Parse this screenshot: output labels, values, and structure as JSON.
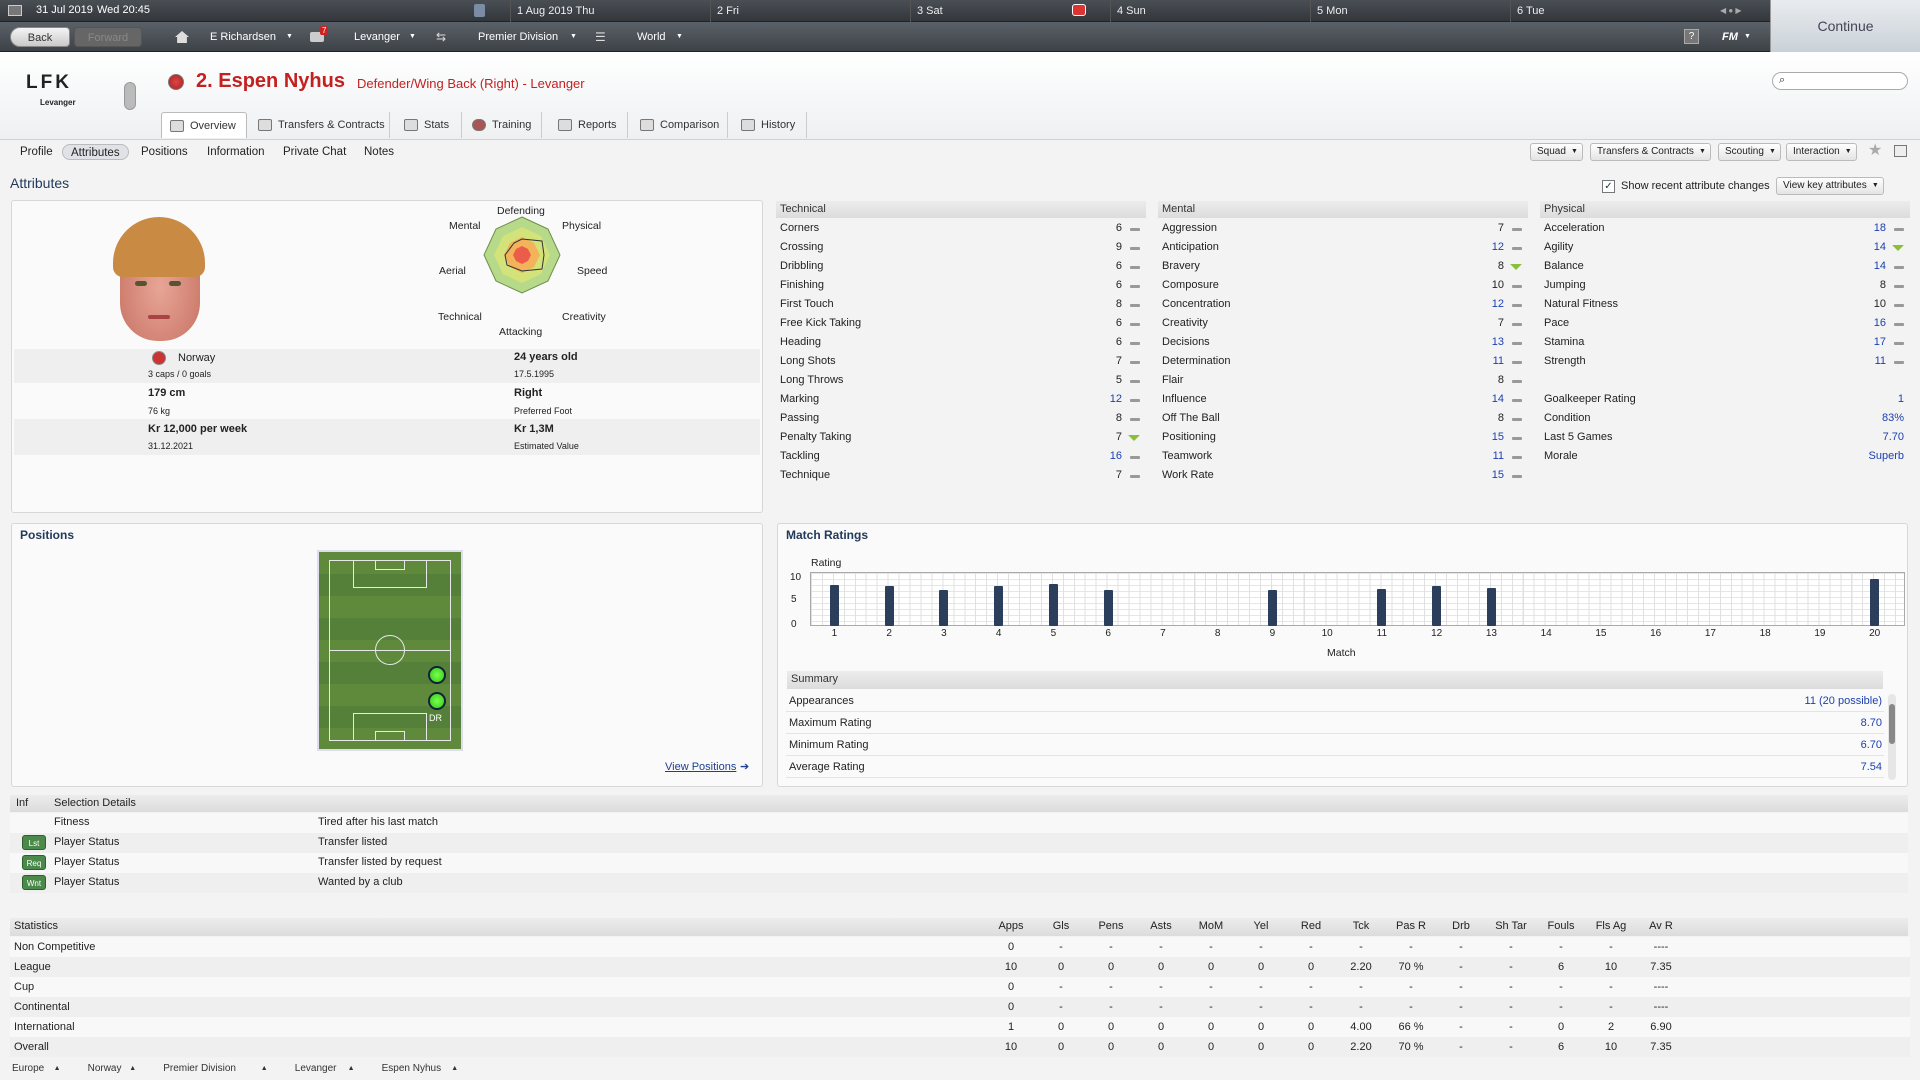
{
  "topbar": {
    "date": "31 Jul 2019",
    "day": "Wed 20:45",
    "cal": [
      "1 Aug 2019  Thu",
      "2  Fri",
      "3  Sat",
      "4  Sun",
      "5  Mon",
      "6  Tue"
    ]
  },
  "nav": {
    "back": "Back",
    "forward": "Forward",
    "manager": "E Richardsen",
    "club": "Levanger",
    "division": "Premier Division",
    "world": "World",
    "fm": "FM",
    "mail_count": "7",
    "continue": "Continue"
  },
  "player": {
    "title": "2. Espen Nyhus",
    "role": "Defender/Wing Back (Right) - Levanger",
    "club_logo": "LFK",
    "club_caption": "Levanger"
  },
  "tabs": [
    "Overview",
    "Transfers & Contracts",
    "Stats",
    "Training",
    "Reports",
    "Comparison",
    "History"
  ],
  "subnav": [
    "Profile",
    "Attributes",
    "Positions",
    "Information",
    "Private Chat",
    "Notes"
  ],
  "dropdowns": [
    "Squad",
    "Transfers & Contracts",
    "Scouting",
    "Interaction"
  ],
  "section_title": "Attributes",
  "show_recent": "Show recent attribute changes",
  "view_key": "View key attributes",
  "radar_labels": {
    "defending": "Defending",
    "physical": "Physical",
    "speed": "Speed",
    "creativity": "Creativity",
    "attacking": "Attacking",
    "technical": "Technical",
    "aerial": "Aerial",
    "mental": "Mental"
  },
  "bio": {
    "nation": "Norway",
    "caps": "3 caps / 0 goals",
    "age": "24 years old",
    "dob": "17.5.1995",
    "height": "179 cm",
    "foot": "Right",
    "weight": "76 kg",
    "foot_label": "Preferred Foot",
    "wage": "Kr 12,000 per week",
    "value": "Kr 1,3M",
    "contract": "31.12.2021",
    "value_label": "Estimated Value"
  },
  "technical": {
    "title": "Technical",
    "items": [
      [
        "Corners",
        "6",
        "n"
      ],
      [
        "Crossing",
        "9",
        "n"
      ],
      [
        "Dribbling",
        "6",
        "n"
      ],
      [
        "Finishing",
        "6",
        "n"
      ],
      [
        "First Touch",
        "8",
        "n"
      ],
      [
        "Free Kick Taking",
        "6",
        "n"
      ],
      [
        "Heading",
        "6",
        "n"
      ],
      [
        "Long Shots",
        "7",
        "n"
      ],
      [
        "Long Throws",
        "5",
        "n"
      ],
      [
        "Marking",
        "12",
        "n"
      ],
      [
        "Passing",
        "8",
        "n"
      ],
      [
        "Penalty Taking",
        "7",
        "u"
      ],
      [
        "Tackling",
        "16",
        "n"
      ],
      [
        "Technique",
        "7",
        "n"
      ]
    ]
  },
  "mental": {
    "title": "Mental",
    "items": [
      [
        "Aggression",
        "7",
        "n"
      ],
      [
        "Anticipation",
        "12",
        "n"
      ],
      [
        "Bravery",
        "8",
        "u"
      ],
      [
        "Composure",
        "10",
        "n"
      ],
      [
        "Concentration",
        "12",
        "n"
      ],
      [
        "Creativity",
        "7",
        "n"
      ],
      [
        "Decisions",
        "13",
        "n"
      ],
      [
        "Determination",
        "11",
        "n"
      ],
      [
        "Flair",
        "8",
        "n"
      ],
      [
        "Influence",
        "14",
        "n"
      ],
      [
        "Off The Ball",
        "8",
        "n"
      ],
      [
        "Positioning",
        "15",
        "n"
      ],
      [
        "Teamwork",
        "11",
        "n"
      ],
      [
        "Work Rate",
        "15",
        "n"
      ]
    ]
  },
  "physical": {
    "title": "Physical",
    "items": [
      [
        "Acceleration",
        "18",
        "n"
      ],
      [
        "Agility",
        "14",
        "u"
      ],
      [
        "Balance",
        "14",
        "n"
      ],
      [
        "Jumping",
        "8",
        "n"
      ],
      [
        "Natural Fitness",
        "10",
        "n"
      ],
      [
        "Pace",
        "16",
        "n"
      ],
      [
        "Stamina",
        "17",
        "n"
      ],
      [
        "Strength",
        "11",
        "n"
      ]
    ],
    "extra": [
      [
        "Goalkeeper Rating",
        "1"
      ],
      [
        "Condition",
        "83%"
      ],
      [
        "Last 5 Games",
        "7.70"
      ],
      [
        "Morale",
        "Superb"
      ]
    ]
  },
  "positions": {
    "title": "Positions",
    "view_link": "View Positions",
    "label": "DR"
  },
  "match_ratings": {
    "title": "Match Ratings",
    "ylabel": "Rating",
    "xlabel": "Match",
    "yticks": [
      "10",
      "5",
      "0"
    ]
  },
  "chart_data": {
    "type": "bar",
    "title": "Match Ratings",
    "xlabel": "Match",
    "ylabel": "Rating",
    "ylim": [
      0,
      10
    ],
    "categories": [
      "1",
      "2",
      "3",
      "4",
      "5",
      "6",
      "7",
      "8",
      "9",
      "10",
      "11",
      "12",
      "13",
      "14",
      "15",
      "16",
      "17",
      "18",
      "19",
      "20"
    ],
    "values": [
      7.6,
      7.5,
      6.7,
      7.5,
      7.7,
      6.6,
      null,
      null,
      6.6,
      null,
      6.8,
      7.5,
      7.0,
      null,
      null,
      null,
      null,
      null,
      null,
      8.7
    ]
  },
  "summary": {
    "title": "Summary",
    "rows": [
      [
        "Appearances",
        "11 (20 possible)"
      ],
      [
        "Maximum Rating",
        "8.70"
      ],
      [
        "Minimum Rating",
        "6.70"
      ],
      [
        "Average Rating",
        "7.54"
      ]
    ]
  },
  "selection": {
    "col1": "Inf",
    "col2": "Selection Details",
    "rows": [
      [
        "",
        "Fitness",
        "Tired after his last match"
      ],
      [
        "Lst",
        "Player Status",
        "Transfer listed"
      ],
      [
        "Req",
        "Player Status",
        "Transfer listed by request"
      ],
      [
        "Wnt",
        "Player Status",
        "Wanted by a club"
      ]
    ]
  },
  "stats": {
    "headers": [
      "Statistics",
      "Apps",
      "Gls",
      "Pens",
      "Asts",
      "MoM",
      "Yel",
      "Red",
      "Tck",
      "Pas R",
      "Drb",
      "Sh Tar",
      "Fouls",
      "Fls Ag",
      "Av R"
    ],
    "rows": [
      [
        "Non Competitive",
        "0",
        "-",
        "-",
        "-",
        "-",
        "-",
        "-",
        "-",
        "-",
        "-",
        "-",
        "-",
        "-",
        "----"
      ],
      [
        "League",
        "10",
        "0",
        "0",
        "0",
        "0",
        "0",
        "0",
        "2.20",
        "70 %",
        "-",
        "-",
        "6",
        "10",
        "7.35"
      ],
      [
        "Cup",
        "0",
        "-",
        "-",
        "-",
        "-",
        "-",
        "-",
        "-",
        "-",
        "-",
        "-",
        "-",
        "-",
        "----"
      ],
      [
        "Continental",
        "0",
        "-",
        "-",
        "-",
        "-",
        "-",
        "-",
        "-",
        "-",
        "-",
        "-",
        "-",
        "-",
        "----"
      ],
      [
        "International",
        "1",
        "0",
        "0",
        "0",
        "0",
        "0",
        "0",
        "4.00",
        "66 %",
        "-",
        "-",
        "0",
        "2",
        "6.90"
      ],
      [
        "Overall",
        "10",
        "0",
        "0",
        "0",
        "0",
        "0",
        "0",
        "2.20",
        "70 %",
        "-",
        "-",
        "6",
        "10",
        "7.35"
      ]
    ]
  },
  "footer": [
    "Europe",
    "Norway",
    "Premier Division",
    "Levanger",
    "Espen Nyhus"
  ]
}
